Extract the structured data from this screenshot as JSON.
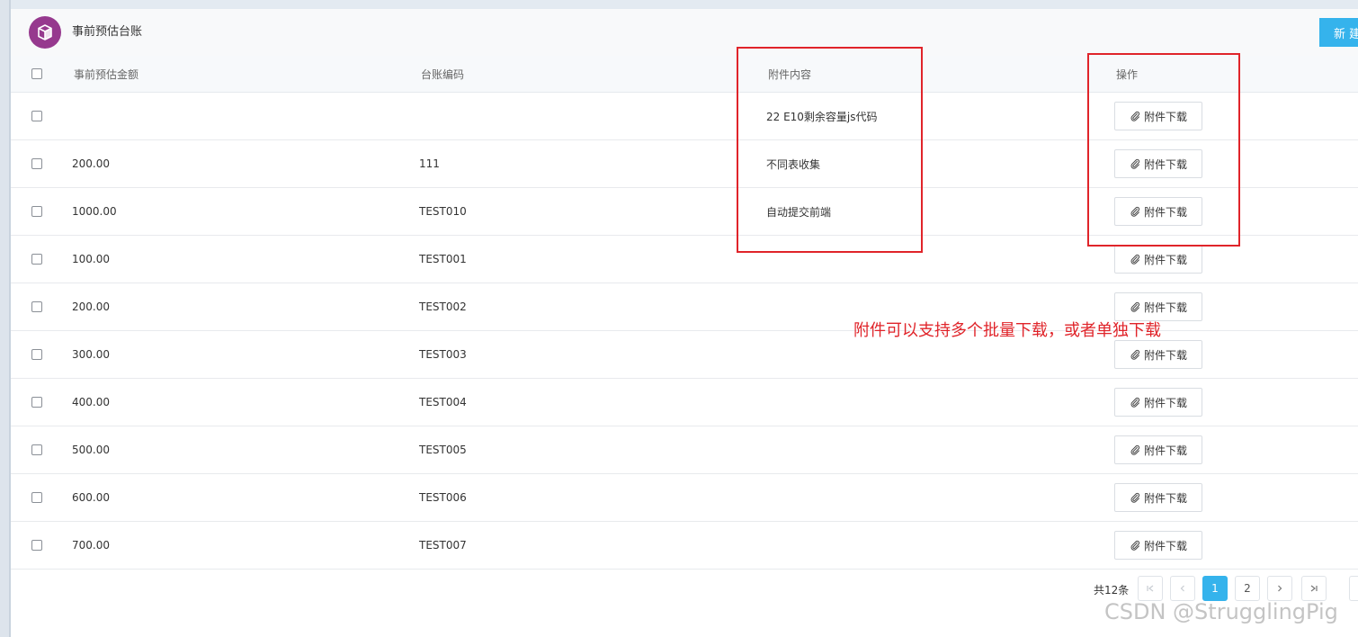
{
  "header": {
    "title": "事前预估台账",
    "new_button_label": "新 建",
    "brand_color": "#96398e",
    "accent_color": "#35b3ec"
  },
  "table": {
    "columns": [
      "事前预估金额",
      "台账编码",
      "附件内容",
      "操作"
    ],
    "rows": [
      {
        "amount": "",
        "code": "",
        "attachment": "22 E10剩余容量js代码",
        "action": "附件下载"
      },
      {
        "amount": "200.00",
        "code": "111",
        "attachment": "不同表收集",
        "action": "附件下载"
      },
      {
        "amount": "1000.00",
        "code": "TEST010",
        "attachment": "自动提交前端",
        "action": "附件下载"
      },
      {
        "amount": "100.00",
        "code": "TEST001",
        "attachment": "",
        "action": "附件下载"
      },
      {
        "amount": "200.00",
        "code": "TEST002",
        "attachment": "",
        "action": "附件下载"
      },
      {
        "amount": "300.00",
        "code": "TEST003",
        "attachment": "",
        "action": "附件下载"
      },
      {
        "amount": "400.00",
        "code": "TEST004",
        "attachment": "",
        "action": "附件下载"
      },
      {
        "amount": "500.00",
        "code": "TEST005",
        "attachment": "",
        "action": "附件下载"
      },
      {
        "amount": "600.00",
        "code": "TEST006",
        "attachment": "",
        "action": "附件下载"
      },
      {
        "amount": "700.00",
        "code": "TEST007",
        "attachment": "",
        "action": "附件下载"
      }
    ]
  },
  "annotation": {
    "text": "附件可以支持多个批量下载，或者单独下载",
    "color": "#e0242a"
  },
  "pagination": {
    "total_label": "共12条",
    "pages": [
      "1",
      "2"
    ],
    "current_page": "1",
    "first_icon": "first-page-icon",
    "prev_icon": "prev-page-icon",
    "next_icon": "next-page-icon",
    "last_icon": "last-page-icon"
  },
  "watermark": "CSDN @StrugglingPig"
}
